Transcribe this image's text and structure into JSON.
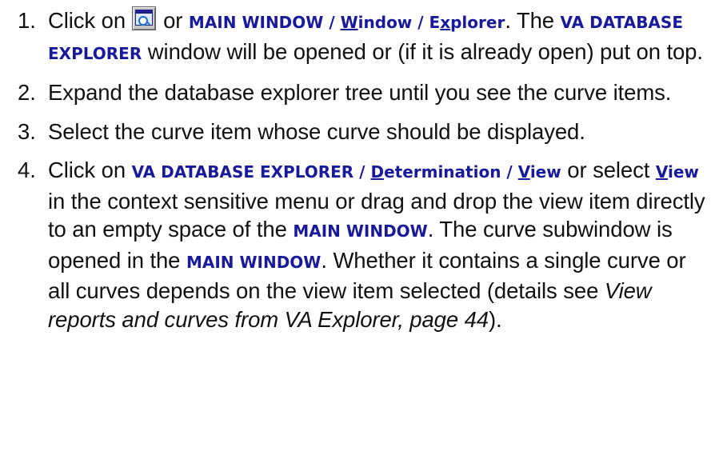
{
  "steps": [
    {
      "num": "1.",
      "click_on": "Click on",
      "toolbar_icon": "explorer-toolbar-icon",
      "or": "or",
      "menu_path": {
        "main_window": "MAIN WINDOW",
        "sep": " / ",
        "window_mn": "W",
        "window_rest": "indow",
        "explorer_pre": "E",
        "explorer_mn": "x",
        "explorer_rest": "plorer"
      },
      "text_a": ". The",
      "db_explorer": "VA DATABASE EXPLORER",
      "text_b": "window will be opened or (if it is already open) put on top."
    },
    {
      "num": "2.",
      "text": "Expand the database explorer tree until you see the curve items."
    },
    {
      "num": "3.",
      "text": "Select the curve item whose curve should be displayed."
    },
    {
      "num": "4.",
      "click_on": "Click on",
      "db_explorer": "VA DATABASE EXPLORER",
      "sep": " / ",
      "determination_mn": "D",
      "determination_rest": "etermination",
      "view_mn": "V",
      "view_rest": "iew",
      "text_a": "or select",
      "text_b": "in the context sensitive menu or drag and drop the view item directly to an empty space of the",
      "main_window": "MAIN WINDOW",
      "text_c": ". The curve subwindow is opened in the",
      "text_d": ". Whether it contains a single curve or all curves depends on the view item selected (details see",
      "xref": "View reports and curves from VA Explorer, page 44",
      "text_e": ")."
    }
  ]
}
